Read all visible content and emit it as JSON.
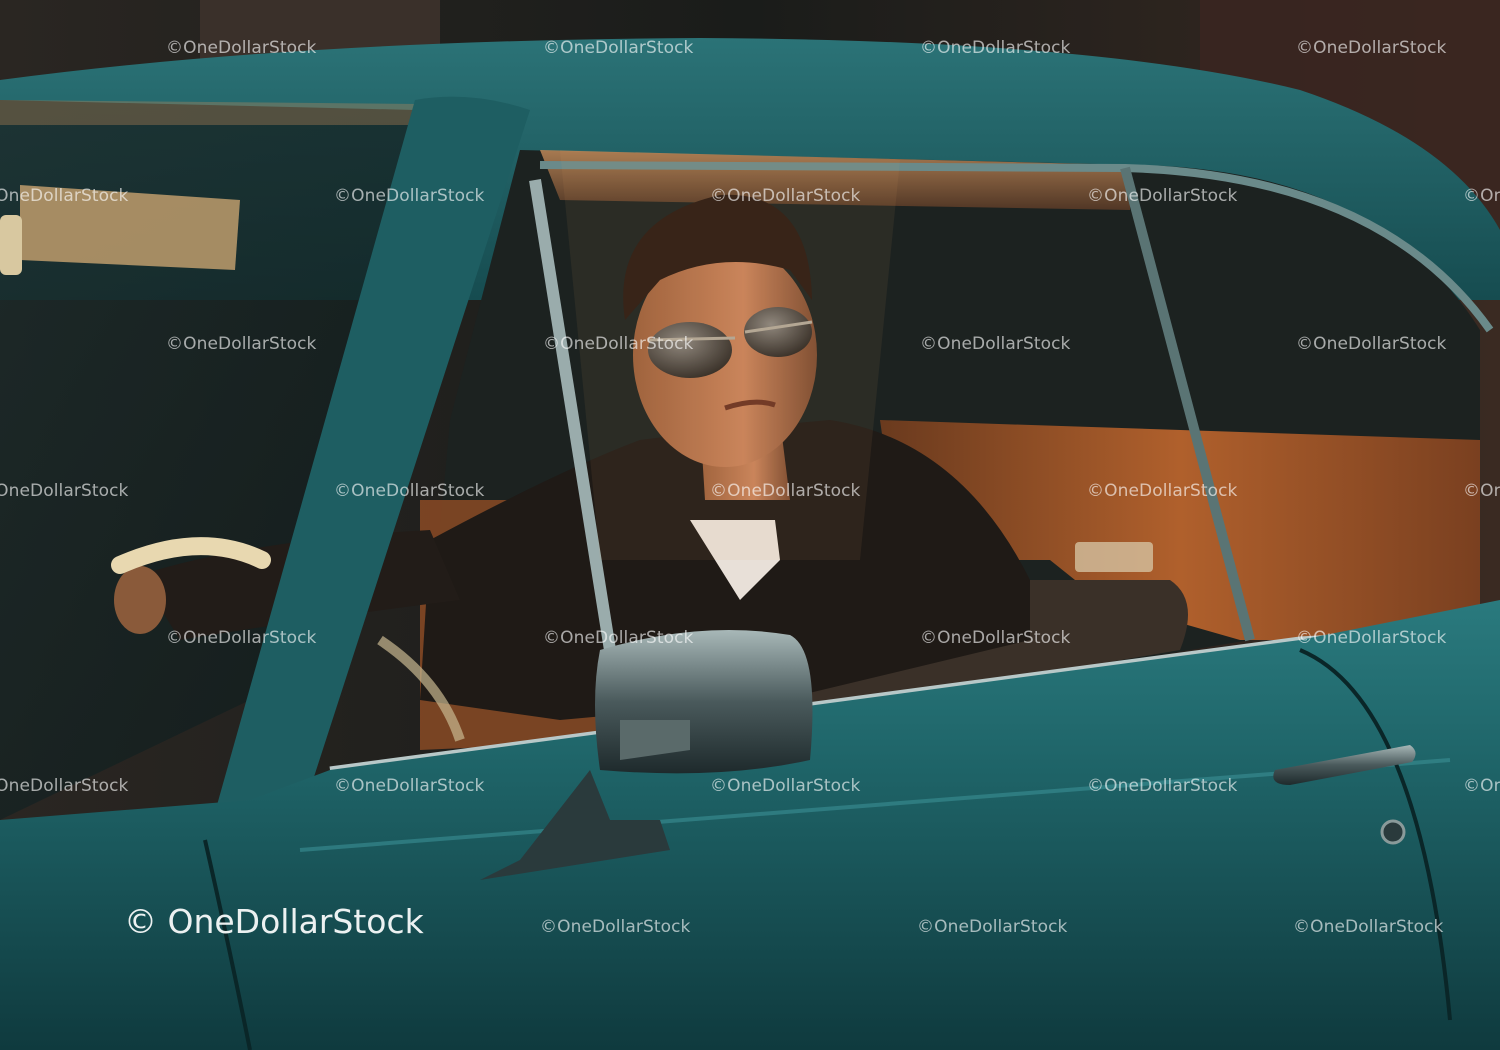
{
  "watermark": {
    "text": "©OneDollarStock",
    "large_text": "© OneDollarStock"
  },
  "colors": {
    "car_body": "#1e6468",
    "car_body_dark": "#0f3a3e",
    "interior_leather": "#a8582a",
    "jacket": "#1f1a16",
    "sunset_glow": "#e8a060"
  }
}
